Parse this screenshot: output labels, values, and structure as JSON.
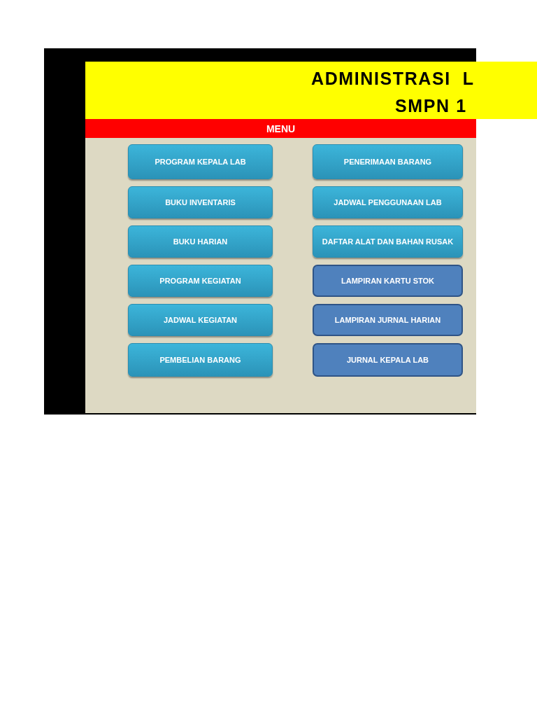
{
  "header": {
    "title": "ADMINISTRASI  L",
    "subtitle": "SMPN 1"
  },
  "menu_bar": {
    "label": "MENU"
  },
  "menu_columns": [
    [
      {
        "label": "PROGRAM KEPALA LAB",
        "kind": "gradient"
      },
      {
        "label": "BUKU INVENTARIS",
        "kind": "gradient"
      },
      {
        "label": "BUKU HARIAN",
        "kind": "gradient"
      },
      {
        "label": "PROGRAM KEGIATAN",
        "kind": "gradient"
      },
      {
        "label": "JADWAL KEGIATAN",
        "kind": "gradient"
      },
      {
        "label": "PEMBELIAN BARANG",
        "kind": "gradient"
      }
    ],
    [
      {
        "label": "PENERIMAAN BARANG",
        "kind": "gradient"
      },
      {
        "label": "JADWAL PENGGUNAAN LAB",
        "kind": "gradient"
      },
      {
        "label": "DAFTAR ALAT DAN BAHAN RUSAK",
        "kind": "gradient"
      },
      {
        "label": "LAMPIRAN KARTU STOK",
        "kind": "outlined"
      },
      {
        "label": "LAMPIRAN JURNAL HARIAN",
        "kind": "outlined"
      },
      {
        "label": "JURNAL KEPALA LAB",
        "kind": "outlined"
      }
    ]
  ]
}
